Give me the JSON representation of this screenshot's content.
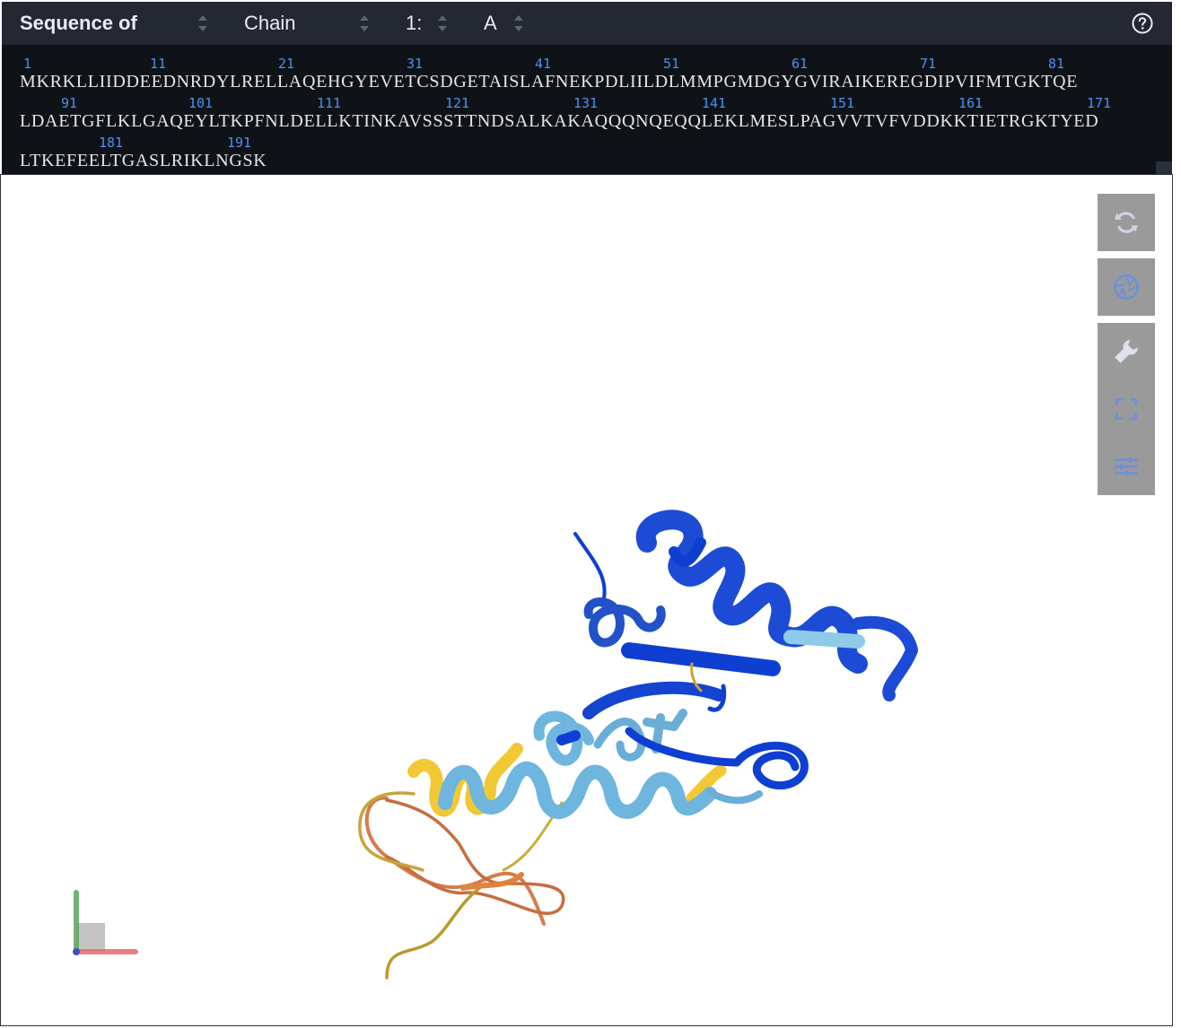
{
  "header": {
    "sequence_of_label": "Sequence of",
    "entity_select_value": "Chain",
    "model_select_value": "1:",
    "chain_select_value": "A",
    "help_icon": "help-circle-icon"
  },
  "sequence": {
    "rows": [
      {
        "numbers": [
          "1",
          "11",
          "21",
          "31",
          "41",
          "51",
          "61",
          "71",
          "81"
        ],
        "residues": "MKRKLLIIDDEEDNRDYLRELLAQEHGYEVETCSDGETAISLAFNEKPDLIILDLMMPGMDGYGVIRAIKEREGDIPVIFMTGKTQE"
      },
      {
        "numbers": [
          "91",
          "101",
          "111",
          "121",
          "131",
          "141",
          "151",
          "161",
          "171"
        ],
        "residues": "LDAETGFLKLGAQEYLTKPFNLDELLKTINKAVSSSTTNDSALKAKAQQQNQEQQLEKLMESLPAGVVTVFVDDKKTIETRGKTYED"
      },
      {
        "numbers": [
          "181",
          "191"
        ],
        "residues": "LTKEFEELTGASLRIKLNGSK"
      }
    ]
  },
  "viewer": {
    "tools": [
      {
        "name": "reset-view-button",
        "icon": "refresh-icon"
      },
      {
        "name": "screenshot-button",
        "icon": "camera-shutter-icon"
      },
      {
        "name": "settings-button",
        "icon": "wrench-icon"
      },
      {
        "name": "fullscreen-button",
        "icon": "expand-icon"
      },
      {
        "name": "controls-button",
        "icon": "sliders-icon"
      }
    ],
    "plddt_colors": {
      "very_high": "#0f3fd1",
      "confident": "#6cb8e0",
      "low": "#f2cf3a",
      "very_low": "#e07b49"
    }
  }
}
